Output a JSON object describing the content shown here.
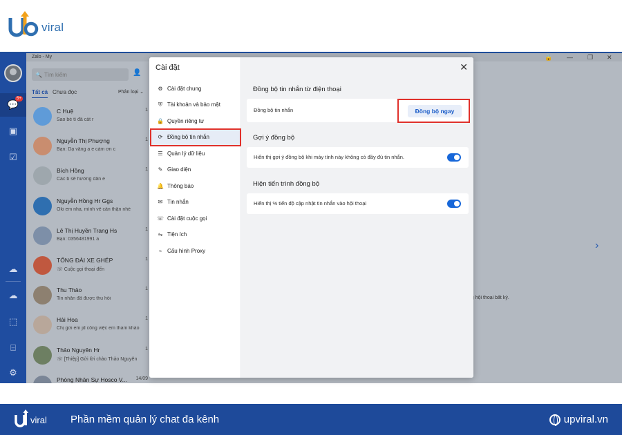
{
  "brand": {
    "wordmark": "viral"
  },
  "window": {
    "title": "Zalo - My",
    "controls": [
      "🔒",
      "—",
      "❐",
      "✕"
    ]
  },
  "rail": {
    "chat_badge": "5+"
  },
  "convlist": {
    "search_placeholder": "Tìm kiếm",
    "tab_all": "Tất cả",
    "tab_unread": "Chưa đọc",
    "classify": "Phân loại ⌄",
    "items": [
      {
        "name": "C Huệ",
        "preview": "Sao bé tí đã cất r",
        "time": "1",
        "color": "#5f9bd8"
      },
      {
        "name": "Nguyễn Thị Phượng",
        "preview": "Bạn: Dạ vâng a e cảm ơn c",
        "time": "1",
        "color": "#c98d6f"
      },
      {
        "name": "Bích Hồng",
        "preview": "Các b sẽ hướng dẫn e",
        "time": "1",
        "color": "#9ea7ad"
      },
      {
        "name": "Nguyễn Hồng Hr Ggs",
        "preview": "Oki em nha, mình về cần thận nhé",
        "time": "",
        "color": "#2f6fb0"
      },
      {
        "name": "Lê Thị Huyền Trang Hs",
        "preview": "Bạn: 0356481991 a",
        "time": "1",
        "color": "#7d8fa8"
      },
      {
        "name": "TỔNG ĐÀI XE GHÉP",
        "preview": "☏ Cuộc gọi thoại đến",
        "time": "1",
        "color": "#c0583f"
      },
      {
        "name": "Thu Thảo",
        "preview": "Tin nhắn đã được thu hồi",
        "time": "1",
        "color": "#8d8070"
      },
      {
        "name": "Hải Hoa",
        "preview": "Chị gửi em jd công việc em tham khảo",
        "time": "1",
        "color": "#b8a79a"
      },
      {
        "name": "Thảo Nguyên Hr",
        "preview": "☏ [Thiệp] Gửi lời chào Thảo Nguyên",
        "time": "1",
        "color": "#6d7f62"
      },
      {
        "name": "Phòng Nhân Sự Hosco V...",
        "preview": "",
        "time": "14/09",
        "color": "#7a8596"
      }
    ]
  },
  "chat": {
    "hint": "ng hội thoại bất kỳ.",
    "next_arrow": "›"
  },
  "settings": {
    "title": "Cài đặt",
    "close_glyph": "✕",
    "nav": [
      {
        "label": "Cài đặt chung",
        "icon": "gear-icon",
        "glyph": "⚙"
      },
      {
        "label": "Tài khoản và bảo mật",
        "icon": "shield-icon",
        "glyph": "⛨"
      },
      {
        "label": "Quyền riêng tư",
        "icon": "lock-icon",
        "glyph": "🔒"
      },
      {
        "label": "Đồng bộ tin nhắn",
        "icon": "sync-icon",
        "glyph": "⟳"
      },
      {
        "label": "Quản lý dữ liệu",
        "icon": "database-icon",
        "glyph": "☰"
      },
      {
        "label": "Giao diện",
        "icon": "brush-icon",
        "glyph": "✎"
      },
      {
        "label": "Thông báo",
        "icon": "bell-icon",
        "glyph": "🔔"
      },
      {
        "label": "Tin nhắn",
        "icon": "message-icon",
        "glyph": "✉"
      },
      {
        "label": "Cài đặt cuộc gọi",
        "icon": "phone-icon",
        "glyph": "☏"
      },
      {
        "label": "Tiện ích",
        "icon": "utility-icon",
        "glyph": "⇋"
      },
      {
        "label": "Cấu hình Proxy",
        "icon": "proxy-icon",
        "glyph": "⌁"
      }
    ],
    "active_index": 3,
    "sections": {
      "sync_title": "Đồng bộ tin nhắn từ điện thoại",
      "sync_label": "Đồng bộ tin nhắn",
      "sync_button": "Đồng bộ ngay",
      "suggest_title": "Gợi ý đồng bộ",
      "suggest_label": "Hiển thị gợi ý đồng bộ khi máy tính này không có đầy đủ tin nhắn.",
      "suggest_enabled": true,
      "progress_title": "Hiện tiến trình đồng bộ",
      "progress_label": "Hiển thị % tiến độ cập nhật tin nhắn vào hội thoại",
      "progress_enabled": true
    }
  },
  "footer": {
    "wordmark": "viral",
    "slogan": "Phần mềm quản lý chat đa kênh",
    "site": "upviral.vn"
  }
}
